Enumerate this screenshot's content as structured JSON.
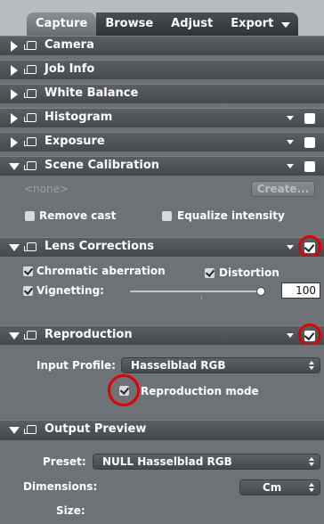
{
  "tabs": [
    {
      "label": "Capture"
    },
    {
      "label": "Browse"
    },
    {
      "label": "Adjust"
    },
    {
      "label": "Export"
    }
  ],
  "sections": {
    "camera": "Camera",
    "job_info": "Job Info",
    "white_balance": "White Balance",
    "histogram": "Histogram",
    "exposure": "Exposure",
    "scene_calibration": "Scene Calibration",
    "lens_corrections": "Lens Corrections",
    "reproduction": "Reproduction",
    "output_preview": "Output Preview"
  },
  "scene": {
    "none_label": "<none>",
    "create_button": "Create...",
    "remove_cast": "Remove cast",
    "equalize_intensity": "Equalize intensity"
  },
  "lens": {
    "chromatic_aberration": "Chromatic aberration",
    "distortion": "Distortion",
    "vignetting_label": "Vignetting:",
    "vignetting_value": "100",
    "vignetting_level": 1.0
  },
  "reproduction": {
    "input_profile_label": "Input Profile:",
    "input_profile_value": "Hasselblad RGB",
    "reproduction_mode": "Reproduction mode"
  },
  "output": {
    "preset_label": "Preset:",
    "preset_value": "NULL Hasselblad RGB",
    "dimensions_label": "Dimensions:",
    "dimensions_value": "Cm",
    "size_label": "Size:"
  },
  "colors": {
    "highlight_ring": "#e00000",
    "panel_bg": "#6e7277",
    "tabbar_bg": "#b9bdc2"
  }
}
